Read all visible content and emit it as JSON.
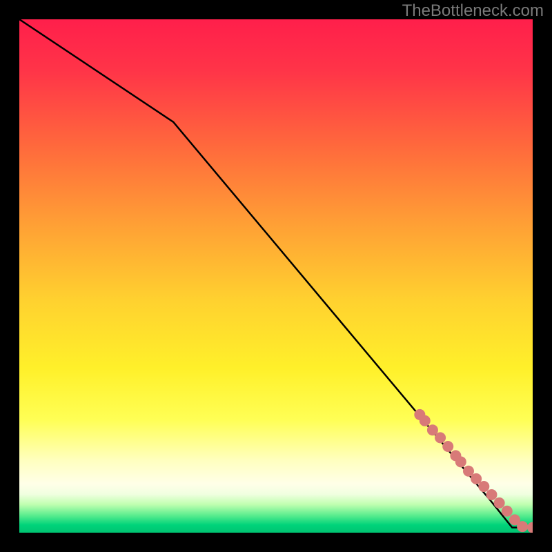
{
  "watermark": "TheBottleneck.com",
  "chart_data": {
    "type": "line",
    "title": "",
    "xlabel": "",
    "ylabel": "",
    "xlim": [
      0,
      100
    ],
    "ylim": [
      0,
      100
    ],
    "gradient_stops": [
      {
        "offset": 0.0,
        "color": "#ff1f4b"
      },
      {
        "offset": 0.1,
        "color": "#ff3448"
      },
      {
        "offset": 0.25,
        "color": "#ff6a3c"
      },
      {
        "offset": 0.4,
        "color": "#ffa035"
      },
      {
        "offset": 0.55,
        "color": "#ffd22f"
      },
      {
        "offset": 0.68,
        "color": "#fff02a"
      },
      {
        "offset": 0.78,
        "color": "#ffff55"
      },
      {
        "offset": 0.86,
        "color": "#ffffc0"
      },
      {
        "offset": 0.905,
        "color": "#ffffe8"
      },
      {
        "offset": 0.925,
        "color": "#f0ffe0"
      },
      {
        "offset": 0.945,
        "color": "#c0ffb0"
      },
      {
        "offset": 0.965,
        "color": "#60ee90"
      },
      {
        "offset": 0.985,
        "color": "#00d37a"
      },
      {
        "offset": 1.0,
        "color": "#00c472"
      }
    ],
    "series": [
      {
        "name": "curve",
        "type": "line",
        "x": [
          0,
          30,
          92,
          96,
          100
        ],
        "values": [
          100,
          80,
          6,
          1,
          1
        ]
      },
      {
        "name": "points",
        "type": "scatter",
        "x": [
          78,
          79,
          80.5,
          82,
          83.5,
          85,
          86,
          87.5,
          89,
          90.5,
          92,
          93.5,
          95,
          96.5,
          98,
          100
        ],
        "values": [
          23,
          21.8,
          20,
          18.5,
          16.8,
          15,
          13.8,
          12,
          10.5,
          9,
          7.4,
          5.8,
          4.2,
          2.5,
          1.2,
          1
        ]
      }
    ],
    "point_color": "#d87a78",
    "line_color": "#000000"
  }
}
